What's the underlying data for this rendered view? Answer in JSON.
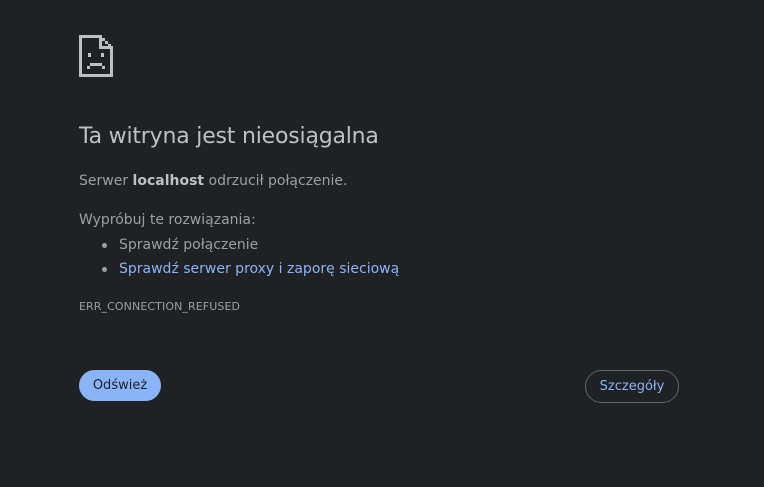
{
  "error_page": {
    "title": "Ta witryna jest nieosiągalna",
    "message_prefix": "Serwer ",
    "message_host": "localhost",
    "message_suffix": " odrzucił połączenie.",
    "suggestions_heading": "Wypróbuj te rozwiązania:",
    "suggestions": [
      {
        "label": "Sprawdź połączenie",
        "is_link": false
      },
      {
        "label": "Sprawdź serwer proxy i zaporę sieciową",
        "is_link": true
      }
    ],
    "error_code": "ERR_CONNECTION_REFUSED",
    "icon": "sad-page-icon"
  },
  "buttons": {
    "reload_label": "Odśwież",
    "details_label": "Szczegóły"
  },
  "colors": {
    "background": "#202124",
    "title": "#bdc1c6",
    "text": "#9aa0a6",
    "link": "#8ab4f8",
    "primary_button": "#8ab4f8",
    "button_border": "#5f6368"
  }
}
